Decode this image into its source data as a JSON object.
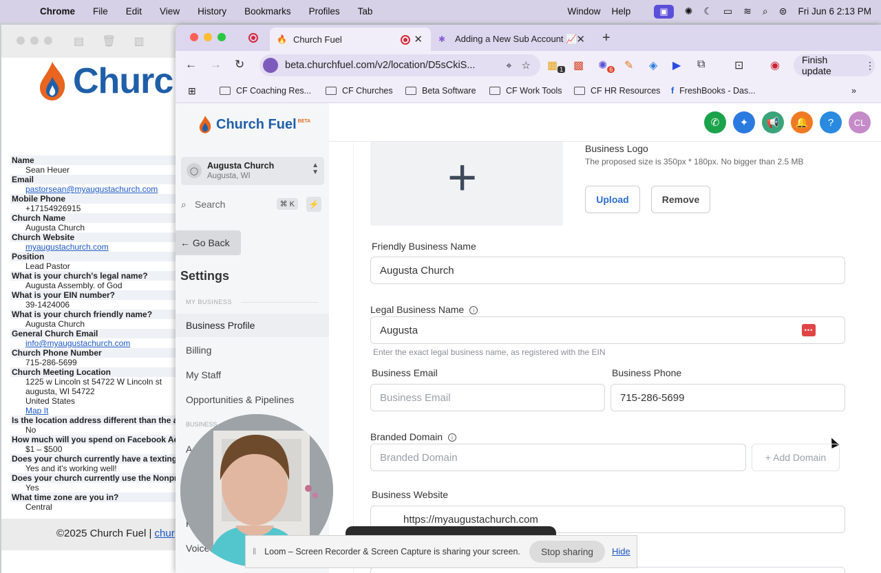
{
  "menubar": {
    "app": "Chrome",
    "items": [
      "File",
      "Edit",
      "View",
      "History",
      "Bookmarks",
      "Profiles",
      "Tab"
    ],
    "right_items": [
      "Window",
      "Help"
    ],
    "datetime": "Fri Jun 6  2:13 PM"
  },
  "email": {
    "brand": "Churc",
    "fields": [
      {
        "label": "Name",
        "value": "Sean Heuer",
        "link": false
      },
      {
        "label": "Email",
        "value": "pastorsean@myaugustachurch.com",
        "link": true
      },
      {
        "label": "Mobile Phone",
        "value": "+17154926915",
        "link": false
      },
      {
        "label": "Church Name",
        "value": "Augusta Church",
        "link": false
      },
      {
        "label": "Church Website",
        "value": "myaugustachurch.com",
        "link": true
      },
      {
        "label": "Position",
        "value": "Lead Pastor",
        "link": false
      },
      {
        "label": "What is your church's legal name?",
        "value": "Augusta Assembly. of God",
        "link": false
      },
      {
        "label": "What is your EIN number?",
        "value": "39-1424006",
        "link": false
      },
      {
        "label": "What is your church friendly name?",
        "value": "Augusta Church",
        "link": false
      },
      {
        "label": "General Church Email",
        "value": "info@myaugustachurch.com",
        "link": true
      },
      {
        "label": "Church Phone Number",
        "value": "715-286-5699",
        "link": false
      },
      {
        "label": "Church Meeting Location",
        "values": [
          "1225 w Lincoln st 54722 W Lincoln st",
          "augusta, WI 54722",
          "United States",
          "Map It"
        ]
      },
      {
        "label": "Is the location address different than the a",
        "value": "No",
        "link": false
      },
      {
        "label": "How much will you spend on Facebook Ad",
        "value": "$1 – $500",
        "link": false
      },
      {
        "label": "Does your church currently have a texting",
        "value": "Yes and it's working well!",
        "link": false
      },
      {
        "label": "Does your church currently use the Nonpr",
        "value": "Yes",
        "link": false
      },
      {
        "label": "What time zone are you in?",
        "value": "Central",
        "link": false
      }
    ],
    "footer_text": "©2025 Church Fuel | ",
    "footer_link": "chur"
  },
  "tabs": [
    {
      "title": "Church Fuel"
    },
    {
      "title": "Adding a New Sub Account 📈"
    }
  ],
  "omnibox": {
    "url": "beta.churchfuel.com/v2/location/D5sCkiS..."
  },
  "finish_update": "Finish update",
  "ext_badges": {
    "one": "1",
    "six": "6"
  },
  "bookmarks": [
    "CF Coaching Res...",
    "CF Churches",
    "Beta Software",
    "CF Work Tools",
    "CF HR Resources",
    "FreshBooks - Das..."
  ],
  "app": {
    "brand": "Church Fuel",
    "beta": "BETA",
    "location": {
      "name": "Augusta Church",
      "sub": "Augusta, WI"
    },
    "search": {
      "placeholder": "Search",
      "shortcut": "⌘ K"
    },
    "go_back": "← Go Back",
    "settings_title": "Settings",
    "section_my_business": "MY BUSINESS",
    "section_business": "BUSINESS",
    "nav": [
      "Business Profile",
      "Billing",
      "My Staff",
      "Opportunities & Pipelines"
    ],
    "nav_partial": [
      "A",
      "F",
      "Voice"
    ],
    "avatar": "CL"
  },
  "form": {
    "logo_title": "Business Logo",
    "logo_hint": "The proposed size is 350px * 180px. No bigger than 2.5 MB",
    "upload": "Upload",
    "remove": "Remove",
    "friendly_label": "Friendly Business Name",
    "friendly_value": "Augusta Church",
    "legal_label": "Legal Business Name",
    "legal_value": "Augusta",
    "legal_hint": "Enter the exact legal business name, as registered with the EIN",
    "email_label": "Business Email",
    "email_placeholder": "Business Email",
    "phone_label": "Business Phone",
    "phone_value": "715-286-5699",
    "domain_label": "Branded Domain",
    "domain_placeholder": "Branded Domain",
    "add_domain": "+ Add Domain",
    "website_label": "Business Website",
    "website_value": "https://myaugustachurch.com"
  },
  "loom": {
    "message": "Loom – Screen Recorder & Screen Capture is sharing your screen.",
    "stop": "Stop sharing",
    "hide": "Hide"
  }
}
